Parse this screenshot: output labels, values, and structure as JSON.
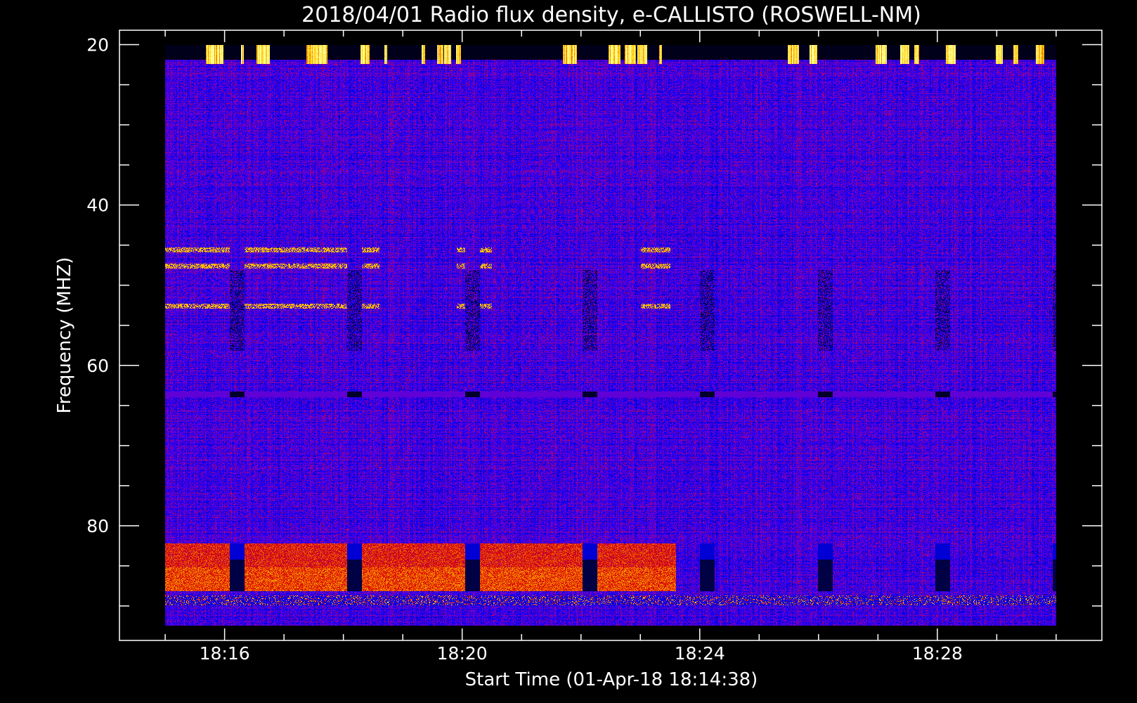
{
  "chart_data": {
    "type": "heatmap",
    "title": "2018/04/01  Radio flux density, e-CALLISTO (ROSWELL-NM)",
    "xlabel": "Start Time (01-Apr-18 18:14:38)",
    "ylabel": "Frequency (MHZ)",
    "x_unit": "minutes after 18:00",
    "xlim": [
      14.23,
      30.77
    ],
    "data_x_range": [
      15.0,
      30.0
    ],
    "x_major_ticks": [
      16,
      20,
      24,
      28
    ],
    "x_tick_labels": [
      "18:16",
      "18:20",
      "18:24",
      "18:28"
    ],
    "x_minor_step": 1,
    "ylim": [
      94.3,
      18.2
    ],
    "data_y_range": [
      20,
      92.3
    ],
    "y_major_ticks": [
      20,
      40,
      60,
      80
    ],
    "y_tick_labels": [
      "20",
      "40",
      "60",
      "80"
    ],
    "y_minor_step": 5,
    "colormap": [
      "#000000",
      "#0000ff",
      "#8000c8",
      "#dc0000",
      "#ffc800",
      "#ffff96"
    ],
    "features": {
      "top_rfi_band_mhz": [
        20,
        22
      ],
      "periodic_gaps_start_min": 16.08,
      "periodic_gaps_every_min": 1.98,
      "periodic_gap_width_min": 0.25,
      "dark_line_mhz": 63.5,
      "red_band_mhz": [
        82,
        88
      ],
      "red_band_until_min": 23.6,
      "bottom_rfi_band_mhz": [
        88.5,
        92.3
      ],
      "carrier_lines_mhz": [
        45.5,
        47.5,
        52.5
      ]
    }
  }
}
